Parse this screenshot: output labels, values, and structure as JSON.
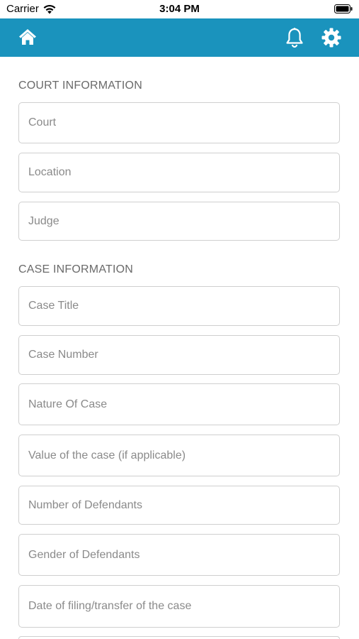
{
  "status_bar": {
    "carrier": "Carrier",
    "time": "3:04 PM"
  },
  "app_bar": {
    "color": "#1a93bd",
    "home_icon": "home-icon",
    "bell_icon": "bell-icon",
    "gear_icon": "gear-icon"
  },
  "court_section": {
    "title": "COURT INFORMATION",
    "fields": [
      {
        "placeholder": "Court"
      },
      {
        "placeholder": "Location"
      },
      {
        "placeholder": "Judge"
      }
    ]
  },
  "case_section": {
    "title": "CASE INFORMATION",
    "fields": [
      {
        "placeholder": "Case Title"
      },
      {
        "placeholder": "Case Number"
      },
      {
        "placeholder": "Nature Of Case"
      },
      {
        "placeholder": "Value of the case (if applicable)"
      },
      {
        "placeholder": "Number of Defendants"
      },
      {
        "placeholder": "Gender of Defendants"
      },
      {
        "placeholder": "Date of filing/transfer of the case"
      }
    ]
  }
}
